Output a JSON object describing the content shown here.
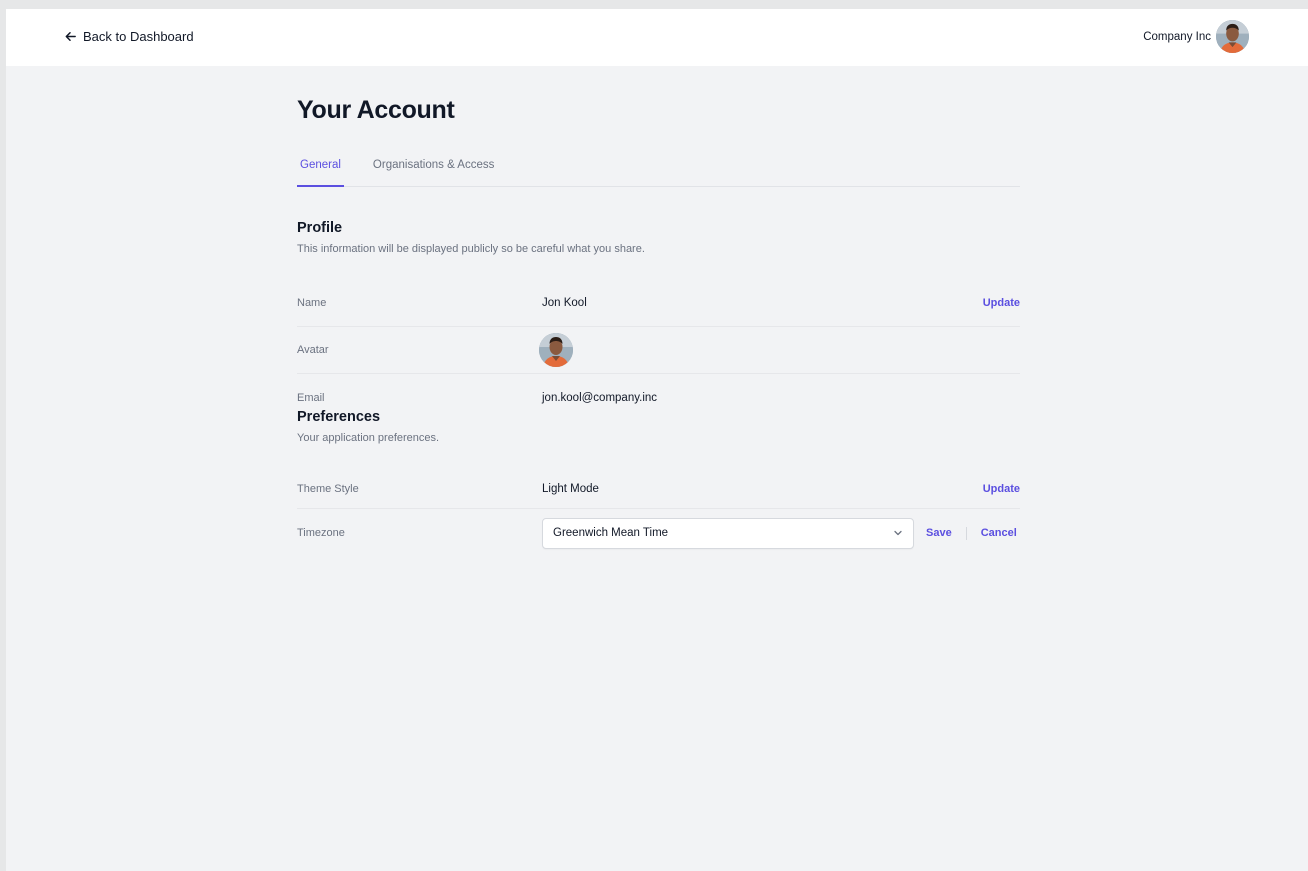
{
  "topbar": {
    "back_label": "Back to Dashboard",
    "org_name": "Company Inc",
    "avatar_icon": "user-avatar"
  },
  "page": {
    "title": "Your Account"
  },
  "tabs": [
    {
      "label": "General",
      "active": true
    },
    {
      "label": "Organisations & Access",
      "active": false
    }
  ],
  "profile": {
    "title": "Profile",
    "description": "This information will be displayed publicly so be careful what you share.",
    "name_label": "Name",
    "name_value": "Jon Kool",
    "name_action": "Update",
    "avatar_label": "Avatar",
    "email_label": "Email",
    "email_value": "jon.kool@company.inc"
  },
  "preferences": {
    "title": "Preferences",
    "description": "Your application preferences.",
    "theme_label": "Theme Style",
    "theme_value": "Light Mode",
    "theme_action": "Update",
    "timezone_label": "Timezone",
    "timezone_value": "Greenwich Mean Time",
    "save_label": "Save",
    "cancel_label": "Cancel"
  },
  "colors": {
    "accent": "#5b4fe0",
    "background": "#f2f3f5",
    "muted_text": "#6b7280"
  }
}
